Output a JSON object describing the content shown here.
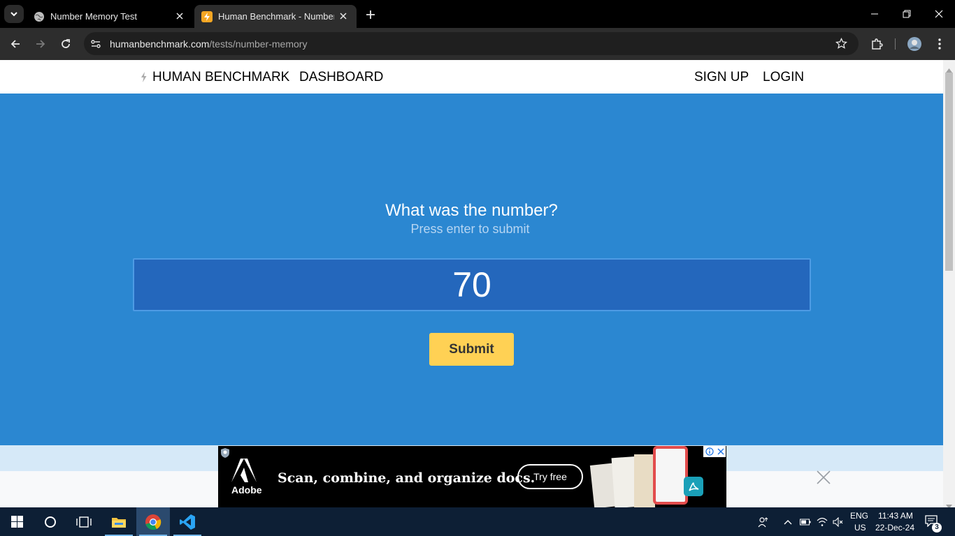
{
  "browser": {
    "tabs": [
      {
        "title": "Number Memory Test"
      },
      {
        "title": "Human Benchmark - Number Memory"
      }
    ],
    "url_domain": "humanbenchmark.com",
    "url_path": "/tests/number-memory"
  },
  "nav": {
    "brand": "HUMAN BENCHMARK",
    "dashboard": "DASHBOARD",
    "signup": "SIGN UP",
    "login": "LOGIN"
  },
  "test": {
    "question": "What was the number?",
    "hint": "Press enter to submit",
    "answer_value": "70",
    "submit_label": "Submit"
  },
  "ad": {
    "headline": "Scan, combine, and organize docs.",
    "cta": "Try free",
    "brand": "Adobe"
  },
  "taskbar": {
    "lang_top": "ENG",
    "lang_bottom": "US",
    "time": "11:43 AM",
    "date": "22-Dec-24",
    "notifications": "3"
  },
  "colors": {
    "page_bg": "#2b87d1",
    "input_bg": "#2467bc",
    "submit_bg": "#ffd154"
  }
}
